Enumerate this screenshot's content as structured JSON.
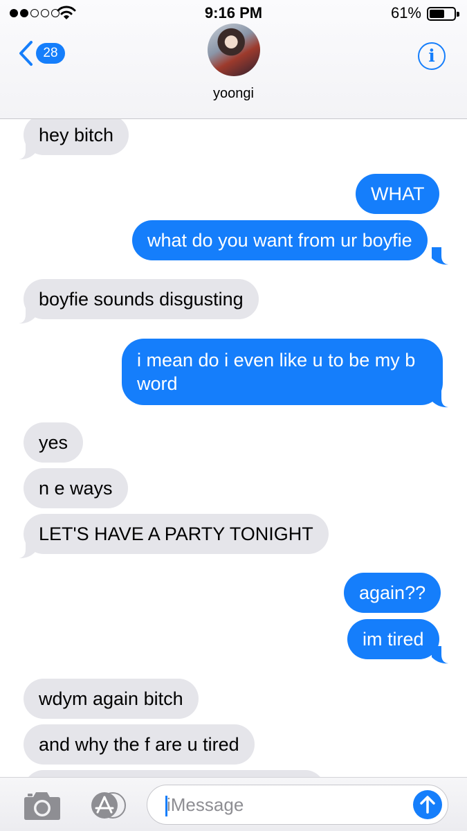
{
  "status_bar": {
    "time": "9:16 PM",
    "battery_percent": "61%",
    "battery_level": 0.61,
    "signal_bars_filled": 2,
    "signal_bars_total": 5,
    "icons": [
      "signal-dots-icon",
      "wifi-icon",
      "battery-icon"
    ]
  },
  "header": {
    "back_count": "28",
    "contact_name": "yoongi",
    "icons": [
      "back-chevron-icon",
      "info-icon"
    ]
  },
  "messages": [
    {
      "from": "them",
      "text": "hey bitch"
    },
    {
      "from": "me",
      "text": "WHAT"
    },
    {
      "from": "me",
      "text": "what do you want from ur boyfie"
    },
    {
      "from": "them",
      "text": "boyfie sounds disgusting"
    },
    {
      "from": "me",
      "text": "i mean do i even like u to be my b word"
    },
    {
      "from": "them",
      "text": "yes"
    },
    {
      "from": "them",
      "text": "n e ways"
    },
    {
      "from": "them",
      "text": "LET'S HAVE A PARTY TONIGHT"
    },
    {
      "from": "me",
      "text": "again??"
    },
    {
      "from": "me",
      "text": "im tired"
    },
    {
      "from": "them",
      "text": "wdym again bitch"
    },
    {
      "from": "them",
      "text": "and why the f are u tired"
    }
  ],
  "input_bar": {
    "placeholder": "iMessage",
    "icons": [
      "camera-icon",
      "app-store-icon",
      "send-arrow-icon"
    ]
  },
  "colors": {
    "sent_bubble": "#157efb",
    "received_bubble": "#e5e5ea",
    "accent": "#157efb"
  }
}
